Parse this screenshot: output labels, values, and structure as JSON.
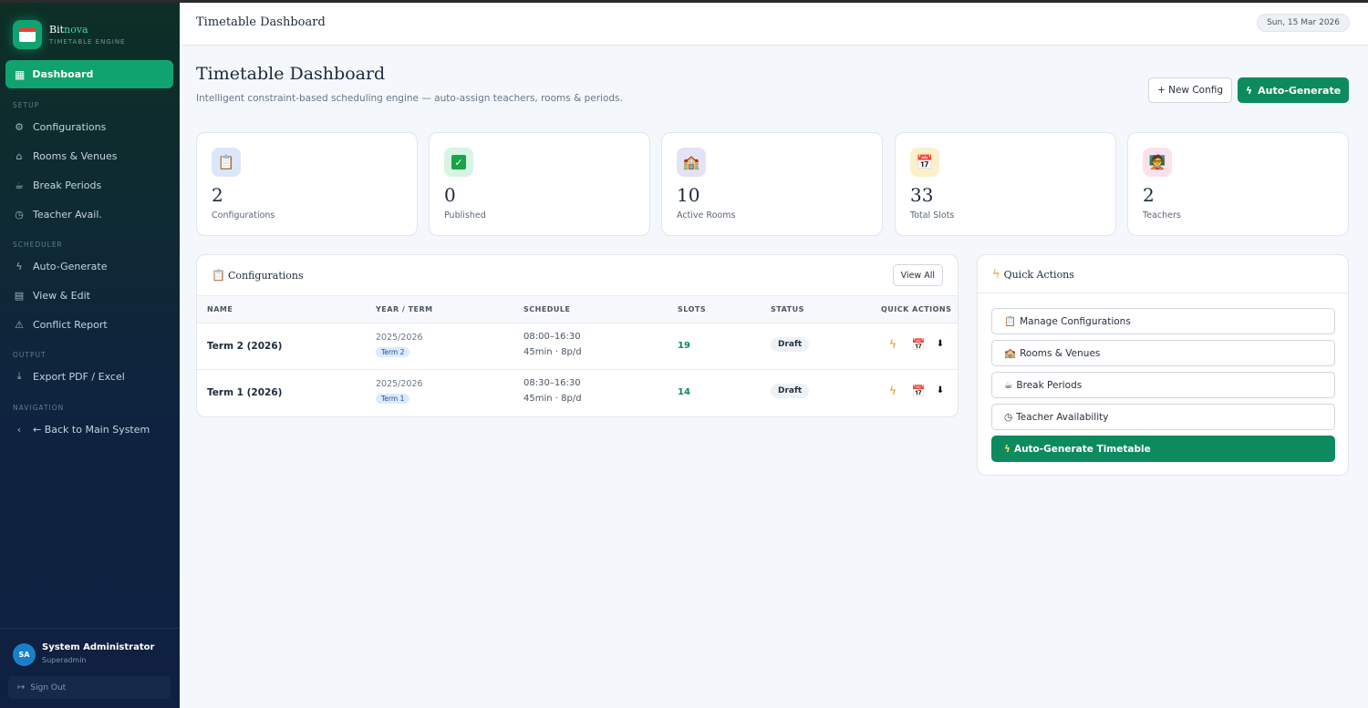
{
  "brand": {
    "name_prefix": "Bit",
    "name_accent": "nova",
    "subtitle": "TIMETABLE ENGINE"
  },
  "sidebar": {
    "active": {
      "label": "Dashboard",
      "icon": "grid-icon"
    },
    "sections": [
      {
        "title": "SETUP",
        "items": [
          {
            "label": "Configurations",
            "icon": "gear-icon"
          },
          {
            "label": "Rooms & Venues",
            "icon": "home-icon"
          },
          {
            "label": "Break Periods",
            "icon": "cup-icon"
          },
          {
            "label": "Teacher Avail.",
            "icon": "clock-icon"
          }
        ]
      },
      {
        "title": "SCHEDULER",
        "items": [
          {
            "label": "Auto-Generate",
            "icon": "bolt-icon"
          },
          {
            "label": "View & Edit",
            "icon": "table-icon"
          },
          {
            "label": "Conflict Report",
            "icon": "warning-icon"
          }
        ]
      },
      {
        "title": "OUTPUT",
        "items": [
          {
            "label": "Export PDF / Excel",
            "icon": "download-icon"
          }
        ]
      },
      {
        "title": "NAVIGATION",
        "items": [
          {
            "label": "← Back to Main System",
            "icon": "chevron-left-icon"
          }
        ]
      }
    ],
    "user": {
      "initials": "SA",
      "name": "System Administrator",
      "role": "Superadmin",
      "sign_out": "Sign Out"
    }
  },
  "topbar": {
    "title": "Timetable Dashboard",
    "date": "Sun, 15 Mar 2026"
  },
  "header": {
    "title": "Timetable Dashboard",
    "subtitle": "Intelligent constraint-based scheduling engine — auto-assign teachers, rooms & periods.",
    "new_config": "+ New Config",
    "auto_generate": "Auto-Generate"
  },
  "stats": [
    {
      "value": "2",
      "label": "Configurations",
      "icon": "clipboard-icon",
      "color": "#dbe7fb"
    },
    {
      "value": "0",
      "label": "Published",
      "icon": "check-icon",
      "color": "#d6f5e3"
    },
    {
      "value": "10",
      "label": "Active Rooms",
      "icon": "school-icon",
      "color": "#e4e2f7"
    },
    {
      "value": "33",
      "label": "Total Slots",
      "icon": "calendar-icon",
      "color": "#fbf0c9"
    },
    {
      "value": "2",
      "label": "Teachers",
      "icon": "teacher-icon",
      "color": "#fbe1ec"
    }
  ],
  "configs": {
    "title": "Configurations",
    "view_all": "View All",
    "columns": [
      "NAME",
      "YEAR / TERM",
      "SCHEDULE",
      "SLOTS",
      "STATUS",
      "QUICK ACTIONS"
    ],
    "rows": [
      {
        "name": "Term 2 (2026)",
        "year": "2025/2026",
        "term": "Term 2",
        "time": "08:00–16:30",
        "period": "45min · 8p/d",
        "slots": "19",
        "status": "Draft"
      },
      {
        "name": "Term 1 (2026)",
        "year": "2025/2026",
        "term": "Term 1",
        "time": "08:30–16:30",
        "period": "45min · 8p/d",
        "slots": "14",
        "status": "Draft"
      }
    ]
  },
  "quick_actions": {
    "title": "Quick Actions",
    "items": [
      {
        "label": "Manage Configurations",
        "icon": "clipboard-icon"
      },
      {
        "label": "Rooms & Venues",
        "icon": "school-icon"
      },
      {
        "label": "Break Periods",
        "icon": "cup-icon"
      },
      {
        "label": "Teacher Availability",
        "icon": "clock-icon"
      },
      {
        "label": "Auto-Generate Timetable",
        "icon": "bolt-icon"
      }
    ]
  },
  "colors": {
    "accent": "#0d8a5e",
    "sidebar_active": "#10a36f"
  }
}
